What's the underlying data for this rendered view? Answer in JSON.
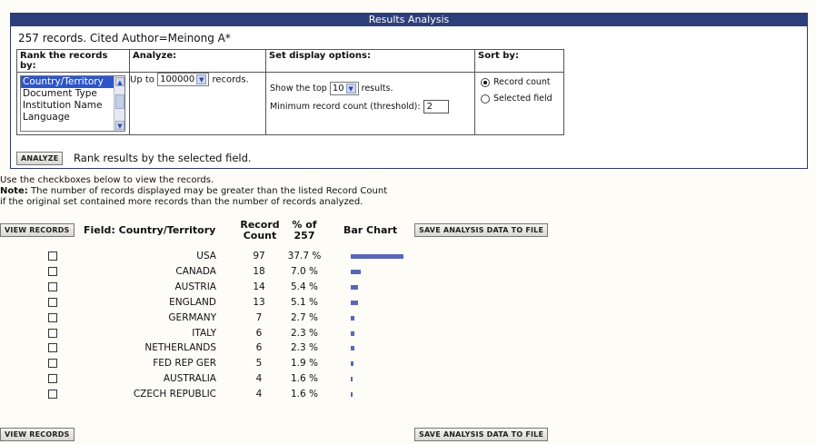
{
  "title": "Results Analysis",
  "summary": "257 records. Cited Author=Meinong A*",
  "rank": {
    "header": "Rank the records by:",
    "items": [
      "Country/Territory",
      "Document Type",
      "Institution Name",
      "Language"
    ],
    "selected": "Country/Territory"
  },
  "analyze": {
    "header": "Analyze:",
    "up_to": "Up to",
    "value": "100000",
    "suffix": "records."
  },
  "display": {
    "header": "Set display options:",
    "show_top": "Show the top",
    "top_value": "10",
    "results": "results.",
    "threshold_label": "Minimum record count (threshold):",
    "threshold_value": "2"
  },
  "sort": {
    "header": "Sort by:",
    "record_count": "Record count",
    "selected_field": "Selected field"
  },
  "analyze_button": "ANALYZE",
  "analyze_hint": "Rank results by the selected field.",
  "notes": {
    "line1": "Use the checkboxes below to view the records.",
    "note_label": "Note:",
    "line2": " The number of records displayed may be greater than the listed Record Count",
    "line3": "if the original set contained more records than the number of records analyzed."
  },
  "table": {
    "view_records": "VIEW RECORDS",
    "save_data": "SAVE ANALYSIS DATA TO FILE",
    "col_field": "Field: Country/Territory",
    "col_count_1": "Record",
    "col_count_2": "Count",
    "col_pct_1": "% of",
    "col_pct_2": "257",
    "col_bar": "Bar Chart",
    "rows": [
      {
        "country": "USA",
        "count": "97",
        "pct": "37.7 %",
        "frac": 0.377
      },
      {
        "country": "CANADA",
        "count": "18",
        "pct": "7.0 %",
        "frac": 0.07
      },
      {
        "country": "AUSTRIA",
        "count": "14",
        "pct": "5.4 %",
        "frac": 0.054
      },
      {
        "country": "ENGLAND",
        "count": "13",
        "pct": "5.1 %",
        "frac": 0.051
      },
      {
        "country": "GERMANY",
        "count": "7",
        "pct": "2.7 %",
        "frac": 0.027
      },
      {
        "country": "ITALY",
        "count": "6",
        "pct": "2.3 %",
        "frac": 0.023
      },
      {
        "country": "NETHERLANDS",
        "count": "6",
        "pct": "2.3 %",
        "frac": 0.023
      },
      {
        "country": "FED REP GER",
        "count": "5",
        "pct": "1.9 %",
        "frac": 0.019
      },
      {
        "country": "AUSTRALIA",
        "count": "4",
        "pct": "1.6 %",
        "frac": 0.016
      },
      {
        "country": "CZECH REPUBLIC",
        "count": "4",
        "pct": "1.6 %",
        "frac": 0.016
      }
    ]
  },
  "colors": {
    "titlebar": "#2d3f7a",
    "bar": "#5a66b8",
    "selection": "#2e55c8"
  }
}
